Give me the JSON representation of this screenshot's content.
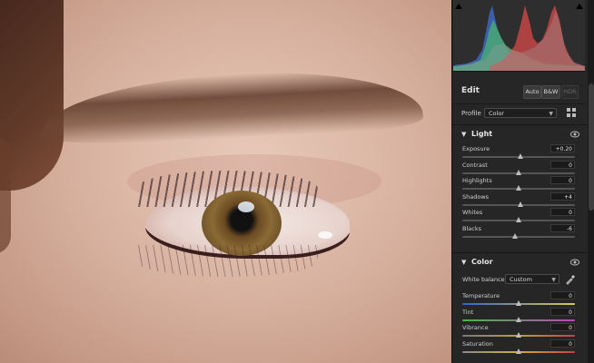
{
  "edit": {
    "title": "Edit",
    "auto": "Auto",
    "bw": "B&W",
    "hdr": "HDR"
  },
  "profile": {
    "label": "Profile",
    "value": "Color"
  },
  "light": {
    "title": "Light",
    "sliders": [
      {
        "label": "Exposure",
        "value": "+0.20",
        "position": 0.52
      },
      {
        "label": "Contrast",
        "value": "0",
        "position": 0.5
      },
      {
        "label": "Highlights",
        "value": "0",
        "position": 0.5
      },
      {
        "label": "Shadows",
        "value": "+4",
        "position": 0.52
      },
      {
        "label": "Whites",
        "value": "0",
        "position": 0.5
      },
      {
        "label": "Blacks",
        "value": "-6",
        "position": 0.47
      }
    ]
  },
  "color": {
    "title": "Color",
    "white_balance_label": "White balance",
    "white_balance_value": "Custom",
    "sliders": [
      {
        "label": "Temperature",
        "value": "0",
        "position": 0.5
      },
      {
        "label": "Tint",
        "value": "0",
        "position": 0.5
      },
      {
        "label": "Vibrance",
        "value": "0",
        "position": 0.5
      },
      {
        "label": "Saturation",
        "value": "0",
        "position": 0.5
      }
    ]
  },
  "icons": {
    "profile_browser": "grid-icon",
    "visibility": "eye-icon",
    "white_balance_picker": "eyedropper-icon"
  },
  "colors": {
    "panel_bg": "#262626",
    "text": "#cfcfcf",
    "histogram_red": "#d94a4a",
    "histogram_green": "#4ab86a",
    "histogram_blue": "#3f6fd6"
  }
}
